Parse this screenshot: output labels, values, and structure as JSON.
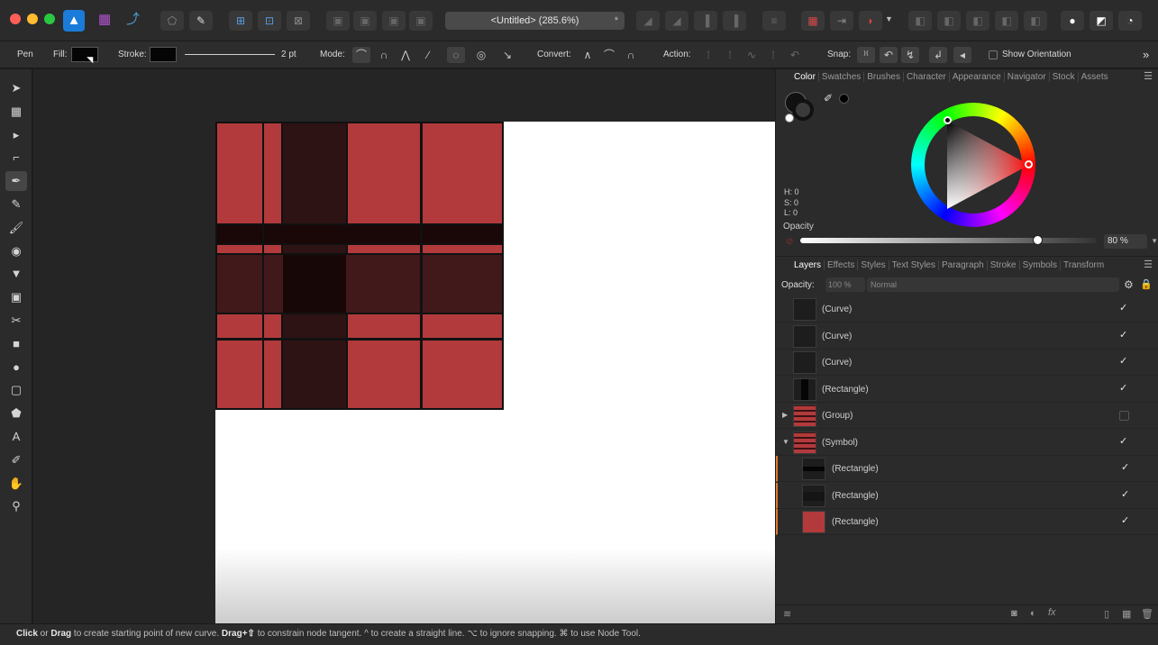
{
  "window": {
    "title": "<Untitled> (285.6%)",
    "title_star": "*",
    "traffic_colors": [
      "#fe5f57",
      "#febc2e",
      "#28c840"
    ]
  },
  "context_toolbar": {
    "tool_name": "Pen",
    "fill_label": "Fill:",
    "stroke_label": "Stroke:",
    "stroke_width": "2 pt",
    "mode_label": "Mode:",
    "convert_label": "Convert:",
    "action_label": "Action:",
    "snap_label": "Snap:",
    "show_orientation_label": "Show Orientation",
    "fill_color": "#050505",
    "stroke_color": "#050505"
  },
  "tools": [
    {
      "name": "move-tool",
      "icon": "➤"
    },
    {
      "name": "artboard-tool",
      "icon": "▦"
    },
    {
      "name": "node-tool",
      "icon": "▸"
    },
    {
      "name": "corner-tool",
      "icon": "⌐"
    },
    {
      "name": "pen-tool",
      "icon": "✒"
    },
    {
      "name": "pencil-tool",
      "icon": "✎"
    },
    {
      "name": "vector-brush-tool",
      "icon": "🖌"
    },
    {
      "name": "fill-tool",
      "icon": "◉"
    },
    {
      "name": "transparency-tool",
      "icon": "▼"
    },
    {
      "name": "place-image-tool",
      "icon": "▣"
    },
    {
      "name": "crop-tool",
      "icon": "✂"
    },
    {
      "name": "rectangle-tool",
      "icon": "■"
    },
    {
      "name": "ellipse-tool",
      "icon": "●"
    },
    {
      "name": "rounded-rectangle-tool",
      "icon": "▢"
    },
    {
      "name": "polygon-tool",
      "icon": "⬟"
    },
    {
      "name": "text-tool",
      "icon": "A"
    },
    {
      "name": "color-picker-tool",
      "icon": "✐"
    },
    {
      "name": "hand-tool",
      "icon": "✋"
    },
    {
      "name": "zoom-tool",
      "icon": "⚲"
    }
  ],
  "color_panel": {
    "tabs": [
      "Color",
      "Swatches",
      "Brushes",
      "Character",
      "Appearance",
      "Navigator",
      "Stock",
      "Assets"
    ],
    "active_tab": "Color",
    "h": "H: 0",
    "s": "S: 0",
    "l": "L: 0",
    "opacity_label": "Opacity",
    "opacity_value": "80 %",
    "opacity_fraction": 0.8
  },
  "layers_panel": {
    "tabs": [
      "Layers",
      "Effects",
      "Styles",
      "Text Styles",
      "Paragraph",
      "Stroke",
      "Symbols",
      "Transform"
    ],
    "active_tab": "Layers",
    "opacity_label": "Opacity:",
    "opacity_value": "100 %",
    "blend_mode": "Normal",
    "layers": [
      {
        "name": "(Curve)",
        "visible": true,
        "expander": "",
        "indent": false,
        "thumb": "dark"
      },
      {
        "name": "(Curve)",
        "visible": true,
        "expander": "",
        "indent": false,
        "thumb": "dark"
      },
      {
        "name": "(Curve)",
        "visible": true,
        "expander": "",
        "indent": false,
        "thumb": "dark"
      },
      {
        "name": "(Rectangle)",
        "visible": true,
        "expander": "",
        "indent": false,
        "thumb": "vbar"
      },
      {
        "name": "(Group)",
        "visible": false,
        "expander": "▶",
        "indent": false,
        "thumb": "plaid"
      },
      {
        "name": "(Symbol)",
        "visible": true,
        "expander": "▼",
        "indent": false,
        "thumb": "plaid"
      },
      {
        "name": "(Rectangle)",
        "visible": true,
        "expander": "",
        "indent": true,
        "thumb": "hbar"
      },
      {
        "name": "(Rectangle)",
        "visible": true,
        "expander": "",
        "indent": true,
        "thumb": "hbar2"
      },
      {
        "name": "(Rectangle)",
        "visible": true,
        "expander": "",
        "indent": true,
        "thumb": "red"
      }
    ]
  },
  "status": {
    "click": "Click",
    "or": " or ",
    "drag": "Drag",
    "t1": " to create starting point of new curve. ",
    "drag_shift": "Drag+⇧",
    "t2": " to constrain node tangent. ^ to create a straight line. ⌥ to ignore snapping. ⌘ to use Node Tool."
  }
}
